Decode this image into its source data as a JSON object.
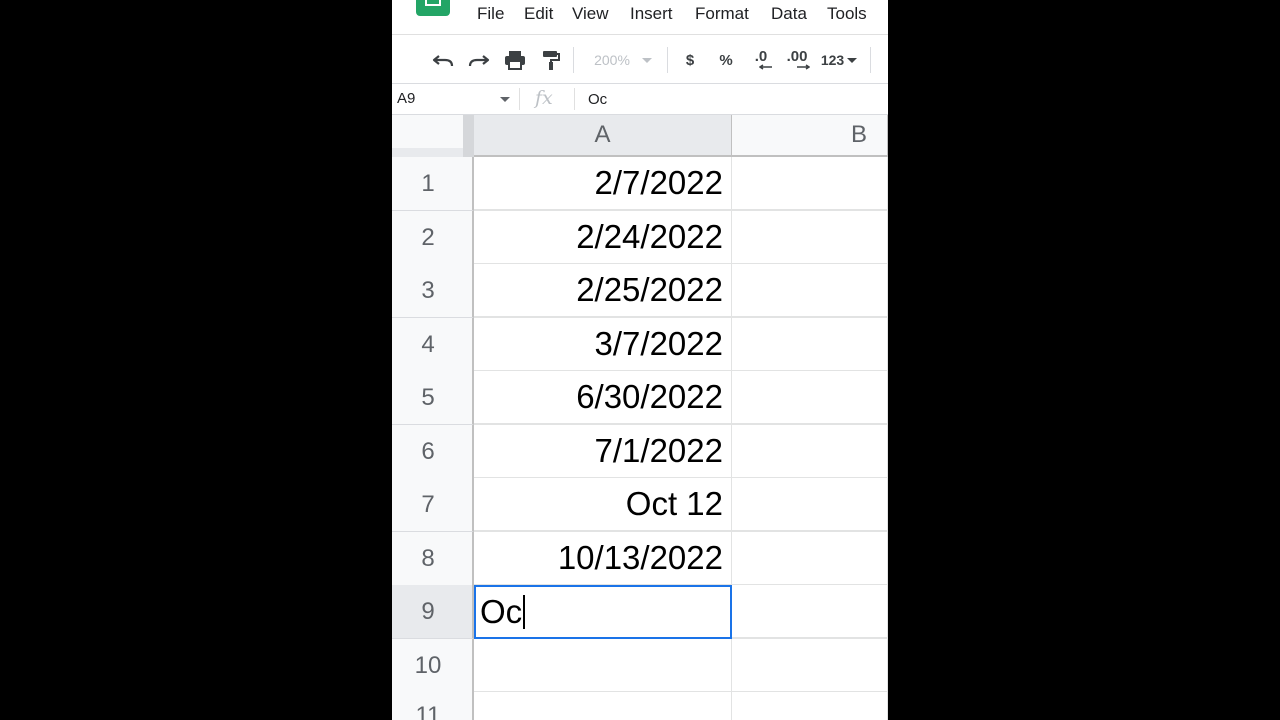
{
  "menu": {
    "items": [
      "File",
      "Edit",
      "View",
      "Insert",
      "Format",
      "Data",
      "Tools"
    ]
  },
  "toolbar": {
    "zoom": "200%",
    "currency": "$",
    "percent": "%",
    "decrease_decimal": ".0",
    "increase_decimal": ".00",
    "more_formats": "123"
  },
  "formula_bar": {
    "name_box": "A9",
    "fx": "fx",
    "content": "Oc"
  },
  "columns": [
    "A",
    "B"
  ],
  "rows": [
    {
      "num": "1",
      "a": "2/7/2022"
    },
    {
      "num": "2",
      "a": "2/24/2022"
    },
    {
      "num": "3",
      "a": "2/25/2022"
    },
    {
      "num": "4",
      "a": "3/7/2022"
    },
    {
      "num": "5",
      "a": "6/30/2022"
    },
    {
      "num": "6",
      "a": "7/1/2022"
    },
    {
      "num": "7",
      "a": "Oct 12"
    },
    {
      "num": "8",
      "a": "10/13/2022"
    },
    {
      "num": "9",
      "a": ""
    },
    {
      "num": "10",
      "a": ""
    },
    {
      "num": "11",
      "a": ""
    }
  ],
  "active_cell": {
    "ref": "A9",
    "editing_text": "Oc"
  },
  "colors": {
    "selection": "#1a73e8",
    "sheets_green": "#23a566"
  }
}
